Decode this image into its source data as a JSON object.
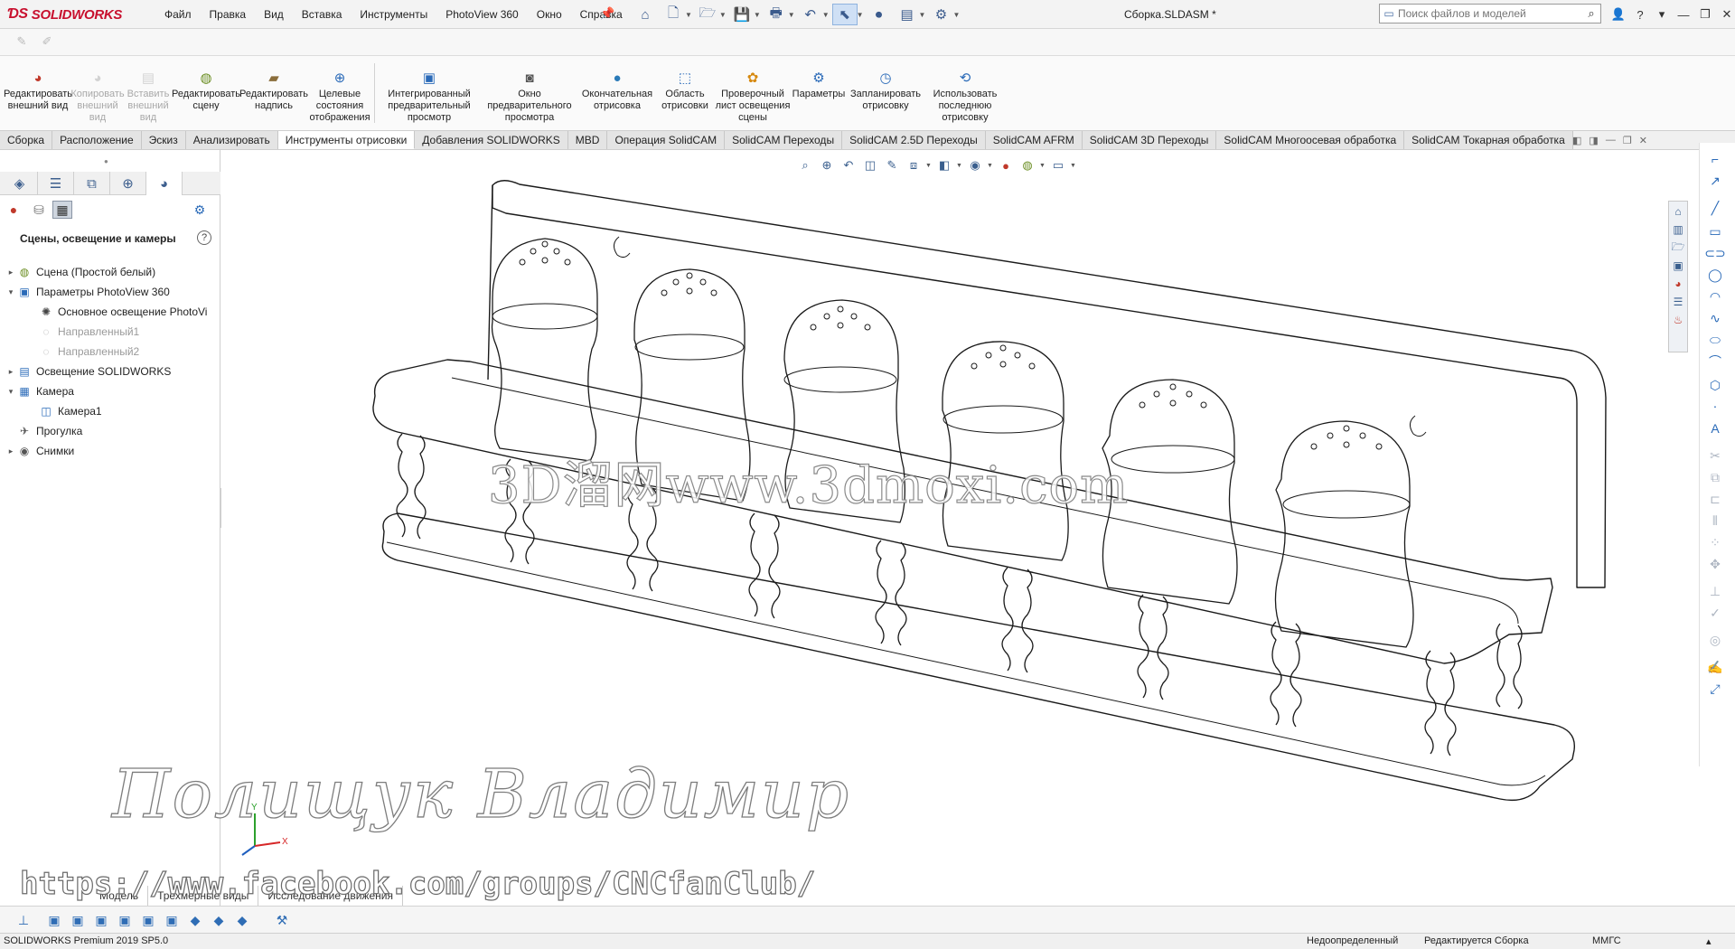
{
  "app": {
    "brand": "SOLIDWORKS",
    "document_title": "Сборка.SLDASM *"
  },
  "menu": [
    "Файл",
    "Правка",
    "Вид",
    "Вставка",
    "Инструменты",
    "PhotoView 360",
    "Окно",
    "Справка"
  ],
  "search": {
    "placeholder": "Поиск файлов и моделей"
  },
  "ribbon": {
    "commands": [
      {
        "label": "Редактировать внешний вид",
        "icon": "appearance-icon",
        "enabled": true
      },
      {
        "label": "Копировать внешний вид",
        "icon": "copy-appearance-icon",
        "enabled": false
      },
      {
        "label": "Вставить внешний вид",
        "icon": "paste-appearance-icon",
        "enabled": false
      },
      {
        "label": "Редактировать сцену",
        "icon": "scene-icon",
        "enabled": true
      },
      {
        "label": "Редактировать надпись",
        "icon": "decal-icon",
        "enabled": true
      },
      {
        "label": "Целевые состояния отображения",
        "icon": "crosshair-icon",
        "enabled": true
      },
      {
        "label": "Интегрированный предварительный просмотр",
        "icon": "integrated-preview-icon",
        "enabled": true
      },
      {
        "label": "Окно предварительного просмотра",
        "icon": "preview-window-icon",
        "enabled": true
      },
      {
        "label": "Окончательная отрисовка",
        "icon": "final-render-icon",
        "enabled": true
      },
      {
        "label": "Область отрисовки",
        "icon": "render-region-icon",
        "enabled": true
      },
      {
        "label": "Проверочный лист освещения сцены",
        "icon": "illumination-proof-icon",
        "enabled": true
      },
      {
        "label": "Параметры",
        "icon": "options-icon",
        "enabled": true
      },
      {
        "label": "Запланировать отрисовку",
        "icon": "schedule-render-icon",
        "enabled": true
      },
      {
        "label": "Использовать последнюю отрисовку",
        "icon": "recall-render-icon",
        "enabled": true
      }
    ]
  },
  "tabs": [
    {
      "label": "Сборка",
      "active": false
    },
    {
      "label": "Расположение",
      "active": false
    },
    {
      "label": "Эскиз",
      "active": false
    },
    {
      "label": "Анализировать",
      "active": false
    },
    {
      "label": "Инструменты отрисовки",
      "active": true
    },
    {
      "label": "Добавления SOLIDWORKS",
      "active": false
    },
    {
      "label": "MBD",
      "active": false
    },
    {
      "label": "Операция SolidCAM",
      "active": false
    },
    {
      "label": "SolidCAM Переходы",
      "active": false
    },
    {
      "label": "SolidCAM 2.5D Переходы",
      "active": false
    },
    {
      "label": "SolidCAM AFRM",
      "active": false
    },
    {
      "label": "SolidCAM 3D Переходы",
      "active": false
    },
    {
      "label": "SolidCAM Многоосевая обработка",
      "active": false
    },
    {
      "label": "SolidCAM Токарная обработка",
      "active": false
    }
  ],
  "panel": {
    "title": "Сцены, освещение и камеры",
    "tree": [
      {
        "label": "Сцена (Простой белый)",
        "level": 0,
        "expander": "▸",
        "icon": "scene-icon",
        "dim": false
      },
      {
        "label": "Параметры PhotoView 360",
        "level": 0,
        "expander": "▾",
        "icon": "photoview-icon",
        "dim": false
      },
      {
        "label": "Основное освещение PhotoVi",
        "level": 1,
        "expander": "",
        "icon": "lighting-icon",
        "dim": false
      },
      {
        "label": "Направленный1",
        "level": 1,
        "expander": "",
        "icon": "directional-light-icon",
        "dim": true
      },
      {
        "label": "Направленный2",
        "level": 1,
        "expander": "",
        "icon": "directional-light-icon",
        "dim": true
      },
      {
        "label": "Освещение SOLIDWORKS",
        "level": 0,
        "expander": "▸",
        "icon": "lighting-folder-icon",
        "dim": false
      },
      {
        "label": "Камера",
        "level": 0,
        "expander": "▾",
        "icon": "camera-folder-icon",
        "dim": false
      },
      {
        "label": "Камера1",
        "level": 1,
        "expander": "",
        "icon": "camera-icon",
        "dim": false
      },
      {
        "label": "Прогулка",
        "level": 0,
        "expander": "",
        "icon": "walkthrough-icon",
        "dim": false
      },
      {
        "label": "Снимки",
        "level": 0,
        "expander": "▸",
        "icon": "snapshot-icon",
        "dim": false
      }
    ]
  },
  "bottom_tabs": [
    "Модель",
    "Трехмерные виды",
    "Исследование движения"
  ],
  "status": {
    "version": "SOLIDWORKS Premium 2019 SP5.0",
    "definition": "Недоопределенный",
    "editing": "Редактируется Сборка",
    "units": "ММГС"
  },
  "watermarks": {
    "site": "3D溜网www.3dmoxi.com",
    "author": "Полищук Владимир",
    "url": "https://www.facebook.com/groups/CNCfanClub/"
  },
  "colors": {
    "brand": "#c8102e",
    "accent": "#2a6ab8",
    "active_tab": "#ffffff"
  }
}
